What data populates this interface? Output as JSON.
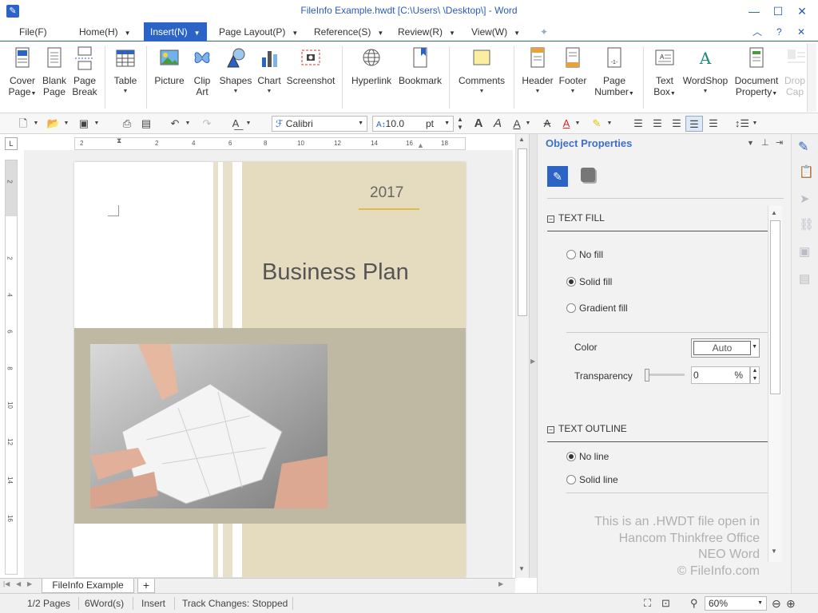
{
  "window": {
    "title": "FileInfo Example.hwdt [C:\\Users\\                    \\Desktop\\] - Word",
    "minimize": "—",
    "maximize": "☐",
    "close": "✕"
  },
  "menu": {
    "file": "File(F)",
    "home": "Home(H)",
    "insert": "Insert(N)",
    "page_layout": "Page Layout(P)",
    "reference": "Reference(S)",
    "review": "Review(R)",
    "view": "View(W)"
  },
  "ribbon": {
    "cover_page": [
      "Cover",
      "Page"
    ],
    "blank_page": [
      "Blank",
      "Page"
    ],
    "page_break": [
      "Page",
      "Break"
    ],
    "table": "Table",
    "picture": "Picture",
    "clip_art": [
      "Clip",
      "Art"
    ],
    "shapes": "Shapes",
    "chart": "Chart",
    "screenshot": "Screenshot",
    "hyperlink": "Hyperlink",
    "bookmark": "Bookmark",
    "comments": "Comments",
    "header": "Header",
    "footer": "Footer",
    "page_number": [
      "Page",
      "Number"
    ],
    "text_box": [
      "Text",
      "Box"
    ],
    "wordshop": "WordShop",
    "document_property": [
      "Document",
      "Property"
    ],
    "drop_cap": [
      "Drop",
      "Cap"
    ]
  },
  "toolbar": {
    "font_name": "Calibri",
    "font_size": "10.0",
    "font_unit": "pt"
  },
  "ruler": {
    "h_ticks": [
      "2",
      "2",
      "4",
      "6",
      "8",
      "10",
      "12",
      "14",
      "16",
      "18"
    ],
    "v_ticks": [
      "2",
      "2",
      "4",
      "6",
      "8",
      "10",
      "12",
      "14",
      "16"
    ]
  },
  "document": {
    "year": "2017",
    "title": "Business Plan",
    "colors": {
      "tan": "#e5dcc0",
      "band": "#bfb8a3",
      "stripe": "#e8e0c8"
    }
  },
  "panel": {
    "title": "Object Properties",
    "text_fill": {
      "heading": "TEXT FILL",
      "options": [
        "No fill",
        "Solid fill",
        "Gradient fill"
      ],
      "selected": "Solid fill",
      "color_label": "Color",
      "color_value": "Auto",
      "transparency_label": "Transparency",
      "transparency_value": "0",
      "transparency_unit": "%"
    },
    "text_outline": {
      "heading": "TEXT OUTLINE",
      "options": [
        "No line",
        "Solid line"
      ],
      "selected": "No line"
    },
    "watermark": [
      "This is an .HWDT file open in",
      "Hancom Thinkfree Office",
      "NEO Word",
      "© FileInfo.com"
    ]
  },
  "tabs": {
    "active": "FileInfo Example",
    "add": "+"
  },
  "status": {
    "pages": "1/2 Pages",
    "words": "6Word(s)",
    "mode": "Insert",
    "track": "Track Changes: Stopped",
    "zoom": "60%"
  },
  "accent": "#2b63c7"
}
